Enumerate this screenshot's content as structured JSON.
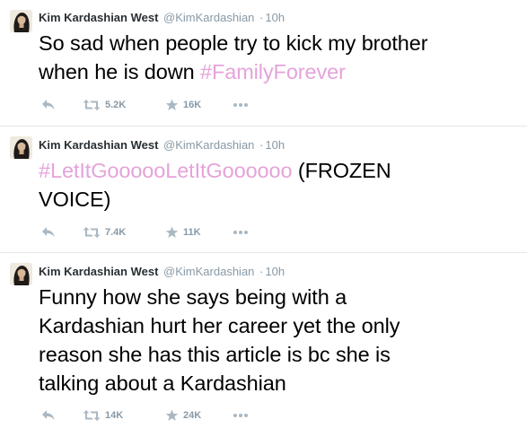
{
  "tweets": [
    {
      "name": "Kim Kardashian West",
      "handle": "@KimKardashian",
      "separator": "·",
      "time": "10h",
      "text_plain": "So sad when people try to kick my brother\nwhen he is down ",
      "hashtag": "#FamilyForever",
      "text_after": "",
      "retweets": "5.2K",
      "favorites": "16K"
    },
    {
      "name": "Kim Kardashian West",
      "handle": "@KimKardashian",
      "separator": "·",
      "time": "10h",
      "text_plain": "",
      "hashtag": "#LetItGoooooLetItGoooooo",
      "text_after": " (FROZEN\nVOICE)",
      "retweets": "7.4K",
      "favorites": "11K"
    },
    {
      "name": "Kim Kardashian West",
      "handle": "@KimKardashian",
      "separator": "·",
      "time": "10h",
      "text_plain": "Funny how she says being with a\nKardashian hurt her career yet the only\nreason she has this article is bc she is\ntalking about a Kardashian",
      "hashtag": "",
      "text_after": "",
      "retweets": "14K",
      "favorites": "24K"
    }
  ],
  "icons": {
    "reply": "reply-icon",
    "retweet": "retweet-icon",
    "favorite": "star-icon",
    "more": "more-icon"
  },
  "colors": {
    "hashtag": "#e5a3da",
    "action_gray": "#aab8c2",
    "meta_gray": "#8899a6",
    "divider": "#e1e8ed"
  }
}
